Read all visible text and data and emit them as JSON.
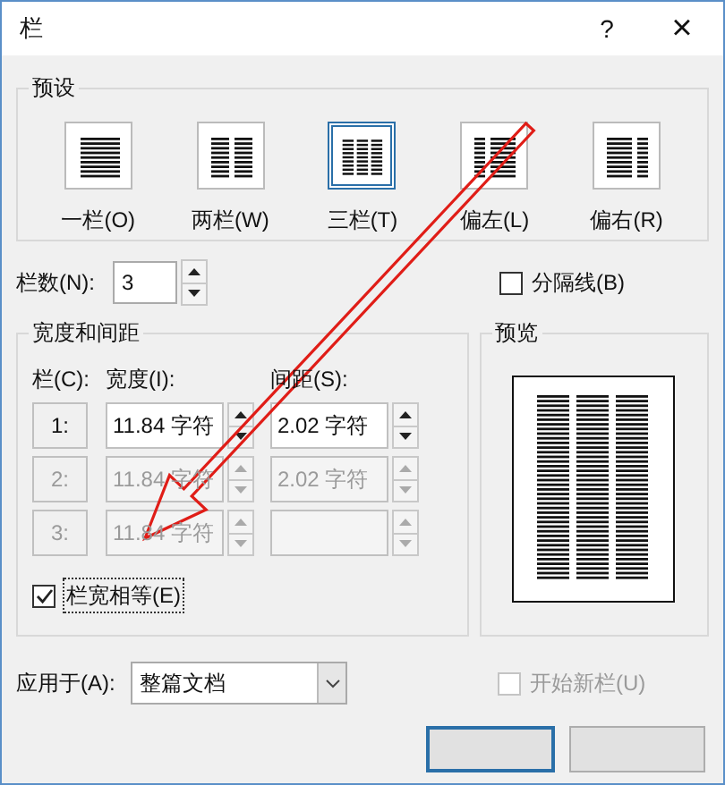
{
  "window": {
    "title": "栏",
    "help": "?",
    "close": "×"
  },
  "presets": {
    "label": "预设",
    "items": [
      {
        "kind": "one",
        "label": "一栏(O)",
        "selected": false
      },
      {
        "kind": "two",
        "label": "两栏(W)",
        "selected": false
      },
      {
        "kind": "three",
        "label": "三栏(T)",
        "selected": true
      },
      {
        "kind": "left",
        "label": "偏左(L)",
        "selected": false
      },
      {
        "kind": "right",
        "label": "偏右(R)",
        "selected": false
      }
    ]
  },
  "column_count": {
    "label": "栏数(N):",
    "value": "3"
  },
  "separator": {
    "label": "分隔线(B)",
    "checked": false
  },
  "width_spacing": {
    "label": "宽度和间距",
    "headers": [
      "栏(C):",
      "宽度(I):",
      "间距(S):"
    ],
    "rows": [
      {
        "number": "1:",
        "width": "11.84 字符",
        "spacing": "2.02 字符",
        "disabled": false
      },
      {
        "number": "2:",
        "width": "11.84 字符",
        "spacing": "2.02 字符",
        "disabled": true
      },
      {
        "number": "3:",
        "width": "11.84 字符",
        "disabled": true
      }
    ]
  },
  "equal_width": {
    "label": "栏宽相等(E)",
    "checked": true
  },
  "preview": {
    "label": "预览"
  },
  "apply_to": {
    "label": "应用于(A):",
    "value": "整篇文档"
  },
  "new_column": {
    "label": "开始新栏(U)",
    "checked": false,
    "disabled": true
  }
}
